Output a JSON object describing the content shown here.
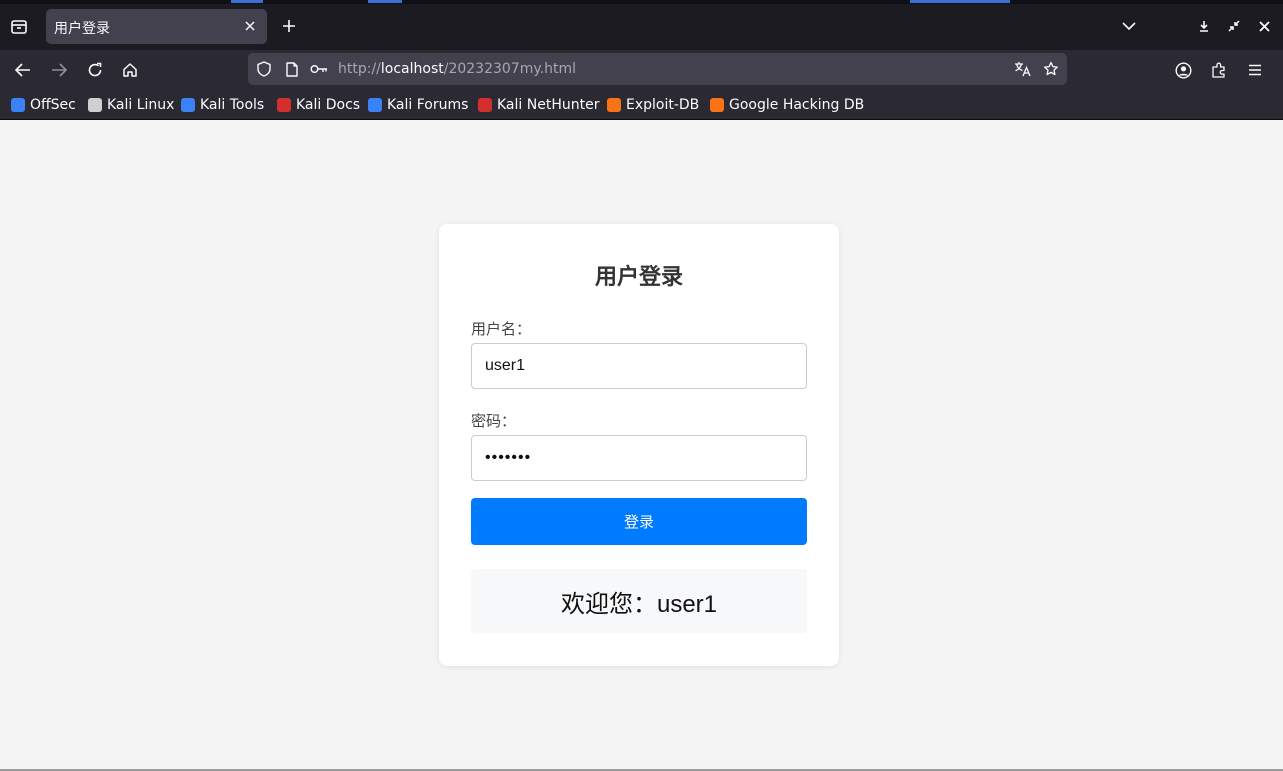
{
  "browser": {
    "tab": {
      "title": "用户登录"
    },
    "url": {
      "scheme": "http://",
      "host": "localhost",
      "path": "/20232307my.html"
    },
    "bookmarks": [
      {
        "label": "OffSec",
        "color": "#3b82f6"
      },
      {
        "label": "Kali Linux",
        "color": "#cfcfcf"
      },
      {
        "label": "Kali Tools",
        "color": "#3b82f6"
      },
      {
        "label": "Kali Docs",
        "color": "#d32f2f"
      },
      {
        "label": "Kali Forums",
        "color": "#3b82f6"
      },
      {
        "label": "Kali NetHunter",
        "color": "#d32f2f"
      },
      {
        "label": "Exploit-DB",
        "color": "#f97316"
      },
      {
        "label": "Google Hacking DB",
        "color": "#f97316"
      }
    ]
  },
  "login": {
    "title": "用户登录",
    "username_label": "用户名：",
    "username_value": "user1",
    "password_label": "密码：",
    "password_mask": "•••••••",
    "submit_label": "登录",
    "welcome_text": "欢迎您：user1"
  },
  "colors": {
    "primary_button": "#007bff",
    "page_background": "#f4f4f4",
    "chrome_dark": "#2b2a33"
  }
}
